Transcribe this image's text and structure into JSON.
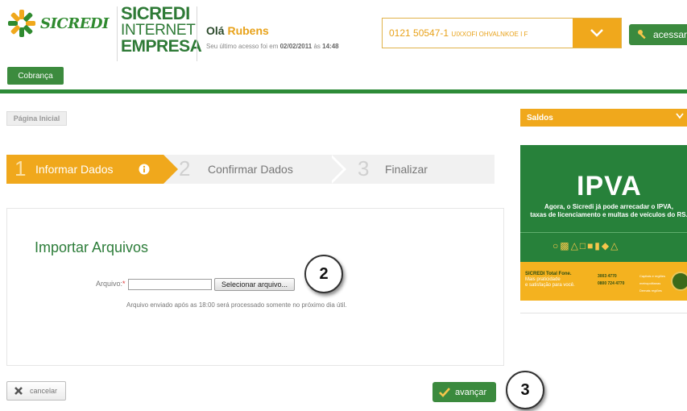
{
  "header": {
    "logo_text": "SICREDI",
    "brand": {
      "line1": "SICREDI",
      "line2": "INTERNET",
      "line3": "EMPRESA"
    },
    "greeting": {
      "prefix": "Olá",
      "name": "Rubens"
    },
    "last_access": {
      "prefix": "Seu último acesso foi em",
      "date": "02/02/2011",
      "mid": "às",
      "time": "14:48"
    },
    "account": {
      "number": "0121 50547-1",
      "holder": "UIXXOFI OHVALNKOE I F"
    },
    "acessar_label": "acessar"
  },
  "nav": {
    "cobranca_label": "Cobrança"
  },
  "breadcrumb": {
    "home_label": "Página Inicial"
  },
  "steps": [
    {
      "num": "1",
      "label": "Informar Dados"
    },
    {
      "num": "2",
      "label": "Confirmar Dados"
    },
    {
      "num": "3",
      "label": "Finalizar"
    }
  ],
  "form": {
    "title": "Importar Arquivos",
    "file_label": "Arquivo:",
    "required_mark": "*",
    "file_value": "",
    "select_button": "Selecionar arquivo...",
    "hint": "Arquivo enviado após as 18:00 será processado somente no próximo dia útil."
  },
  "actions": {
    "cancel_label": "cancelar",
    "next_label": "avançar"
  },
  "callouts": {
    "file": "2",
    "next": "3"
  },
  "sidebar": {
    "saldos_label": "Saldos",
    "ad": {
      "title": "IPVA",
      "line1": "Agora, o Sicredi já pode arrecadar o IPVA,",
      "line2": "taxas de licenciamento e multas de veículos do RS.",
      "footer_brand": "SICREDI Total Fone.",
      "footer_sub1": "Mais praticidade",
      "footer_sub2": "e satisfação para você.",
      "phone1": "3003 4770",
      "phone2": "0800 724 4770",
      "phone_note1": "Capitais e regiões metropolitanas",
      "phone_note2": "Demais regiões"
    }
  },
  "colors": {
    "brand_green": "#2d8b38",
    "accent_orange": "#f0a81c"
  },
  "icons": [
    "sicredi-logo-icon",
    "chevron-down-icon",
    "key-icon",
    "info-icon",
    "close-x-icon",
    "check-icon"
  ]
}
